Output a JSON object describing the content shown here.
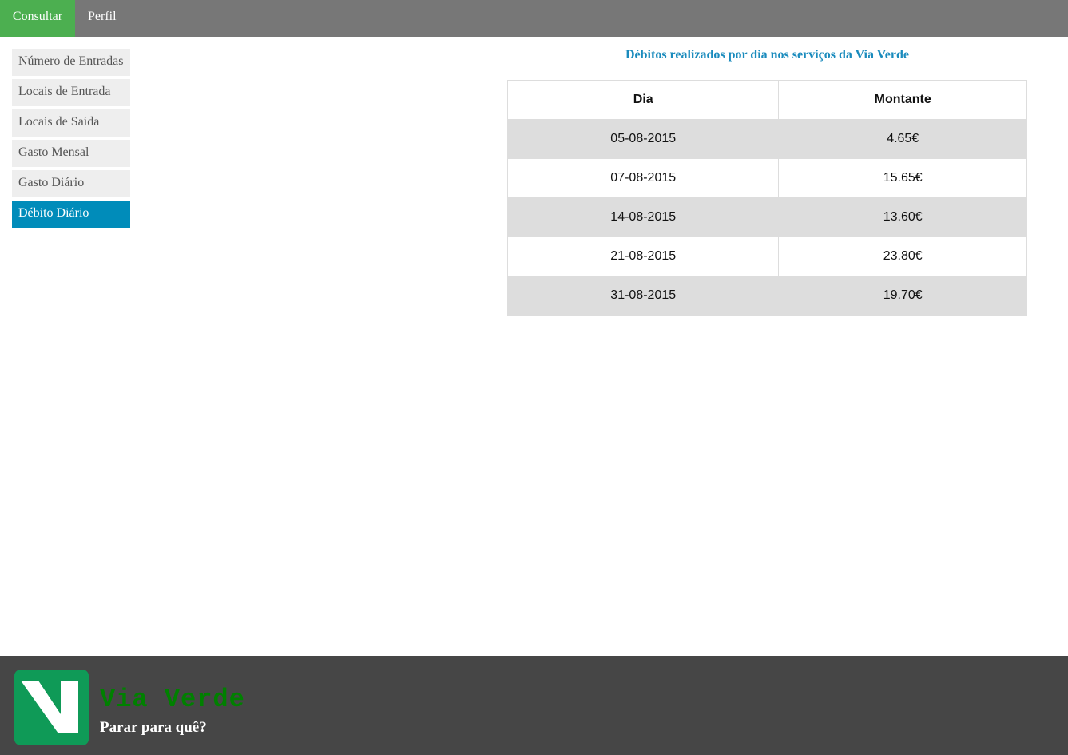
{
  "topnav": {
    "tabs": [
      {
        "label": "Consultar",
        "active": true
      },
      {
        "label": "Perfil",
        "active": false
      }
    ]
  },
  "sidebar": {
    "items": [
      {
        "label": "Número de Entradas",
        "active": false
      },
      {
        "label": "Locais de Entrada",
        "active": false
      },
      {
        "label": "Locais de Saída",
        "active": false
      },
      {
        "label": "Gasto Mensal",
        "active": false
      },
      {
        "label": "Gasto Diário",
        "active": false
      },
      {
        "label": "Débito Diário",
        "active": true
      }
    ]
  },
  "main": {
    "title": "Débitos realizados por dia nos serviços da Via Verde",
    "table": {
      "headers": [
        "Dia",
        "Montante"
      ],
      "rows": [
        [
          "05-08-2015",
          "4.65€"
        ],
        [
          "07-08-2015",
          "15.65€"
        ],
        [
          "14-08-2015",
          "13.60€"
        ],
        [
          "21-08-2015",
          "23.80€"
        ],
        [
          "31-08-2015",
          "19.70€"
        ]
      ]
    }
  },
  "footer": {
    "logo_icon": "via-verde-v-logo-icon",
    "brand": "Via Verde",
    "tagline": "Parar para quê?"
  },
  "colors": {
    "nav_bg": "#777777",
    "nav_active": "#4caf50",
    "sidebar_active": "#008cba",
    "title": "#1a8bbd",
    "footer_bg": "#464646",
    "brand": "#008000",
    "logo_bg": "#0f9a57"
  }
}
